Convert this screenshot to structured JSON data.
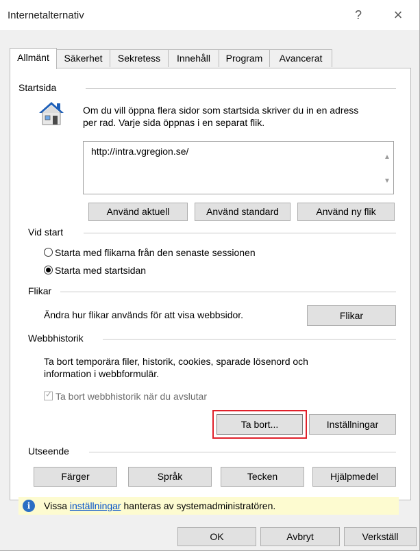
{
  "window": {
    "title": "Internetalternativ",
    "help": "?",
    "close": "×"
  },
  "tabs": [
    "Allmänt",
    "Säkerhet",
    "Sekretess",
    "Innehåll",
    "Program",
    "Avancerat"
  ],
  "startsida": {
    "title": "Startsida",
    "desc1": "Om du vill öppna flera sidor som startsida skriver du in en adress",
    "desc2": "per rad. Varje sida öppnas i en separat flik.",
    "url": "http://intra.vgregion.se/",
    "btn_current": "Använd aktuell",
    "btn_default": "Använd standard",
    "btn_newtab": "Använd ny flik"
  },
  "vidstart": {
    "title": "Vid start",
    "option1": "Starta med flikarna från den senaste sessionen",
    "option2": "Starta med startsidan",
    "selected": 2
  },
  "flikar": {
    "title": "Flikar",
    "desc": "Ändra hur flikar används för att visa webbsidor.",
    "btn": "Flikar"
  },
  "webbhistorik": {
    "title": "Webbhistorik",
    "desc1": "Ta bort temporära filer, historik, cookies, sparade lösenord och",
    "desc2": "information i webbformulär.",
    "checkbox_label": "Ta bort webbhistorik när du avslutar",
    "checkbox_checked": true,
    "btn_delete": "Ta bort...",
    "btn_settings": "Inställningar"
  },
  "utseende": {
    "title": "Utseende",
    "btn_colors": "Färger",
    "btn_language": "Språk",
    "btn_fonts": "Tecken",
    "btn_accessibility": "Hjälpmedel"
  },
  "info": {
    "pre": "Vissa ",
    "link": "inställningar",
    "post": " hanteras av systemadministratören."
  },
  "footer": {
    "ok": "OK",
    "cancel": "Avbryt",
    "apply": "Verkställ"
  },
  "colors": {
    "highlight": "#e0202a",
    "link": "#0050c8",
    "infobar": "#fdfbd0"
  }
}
